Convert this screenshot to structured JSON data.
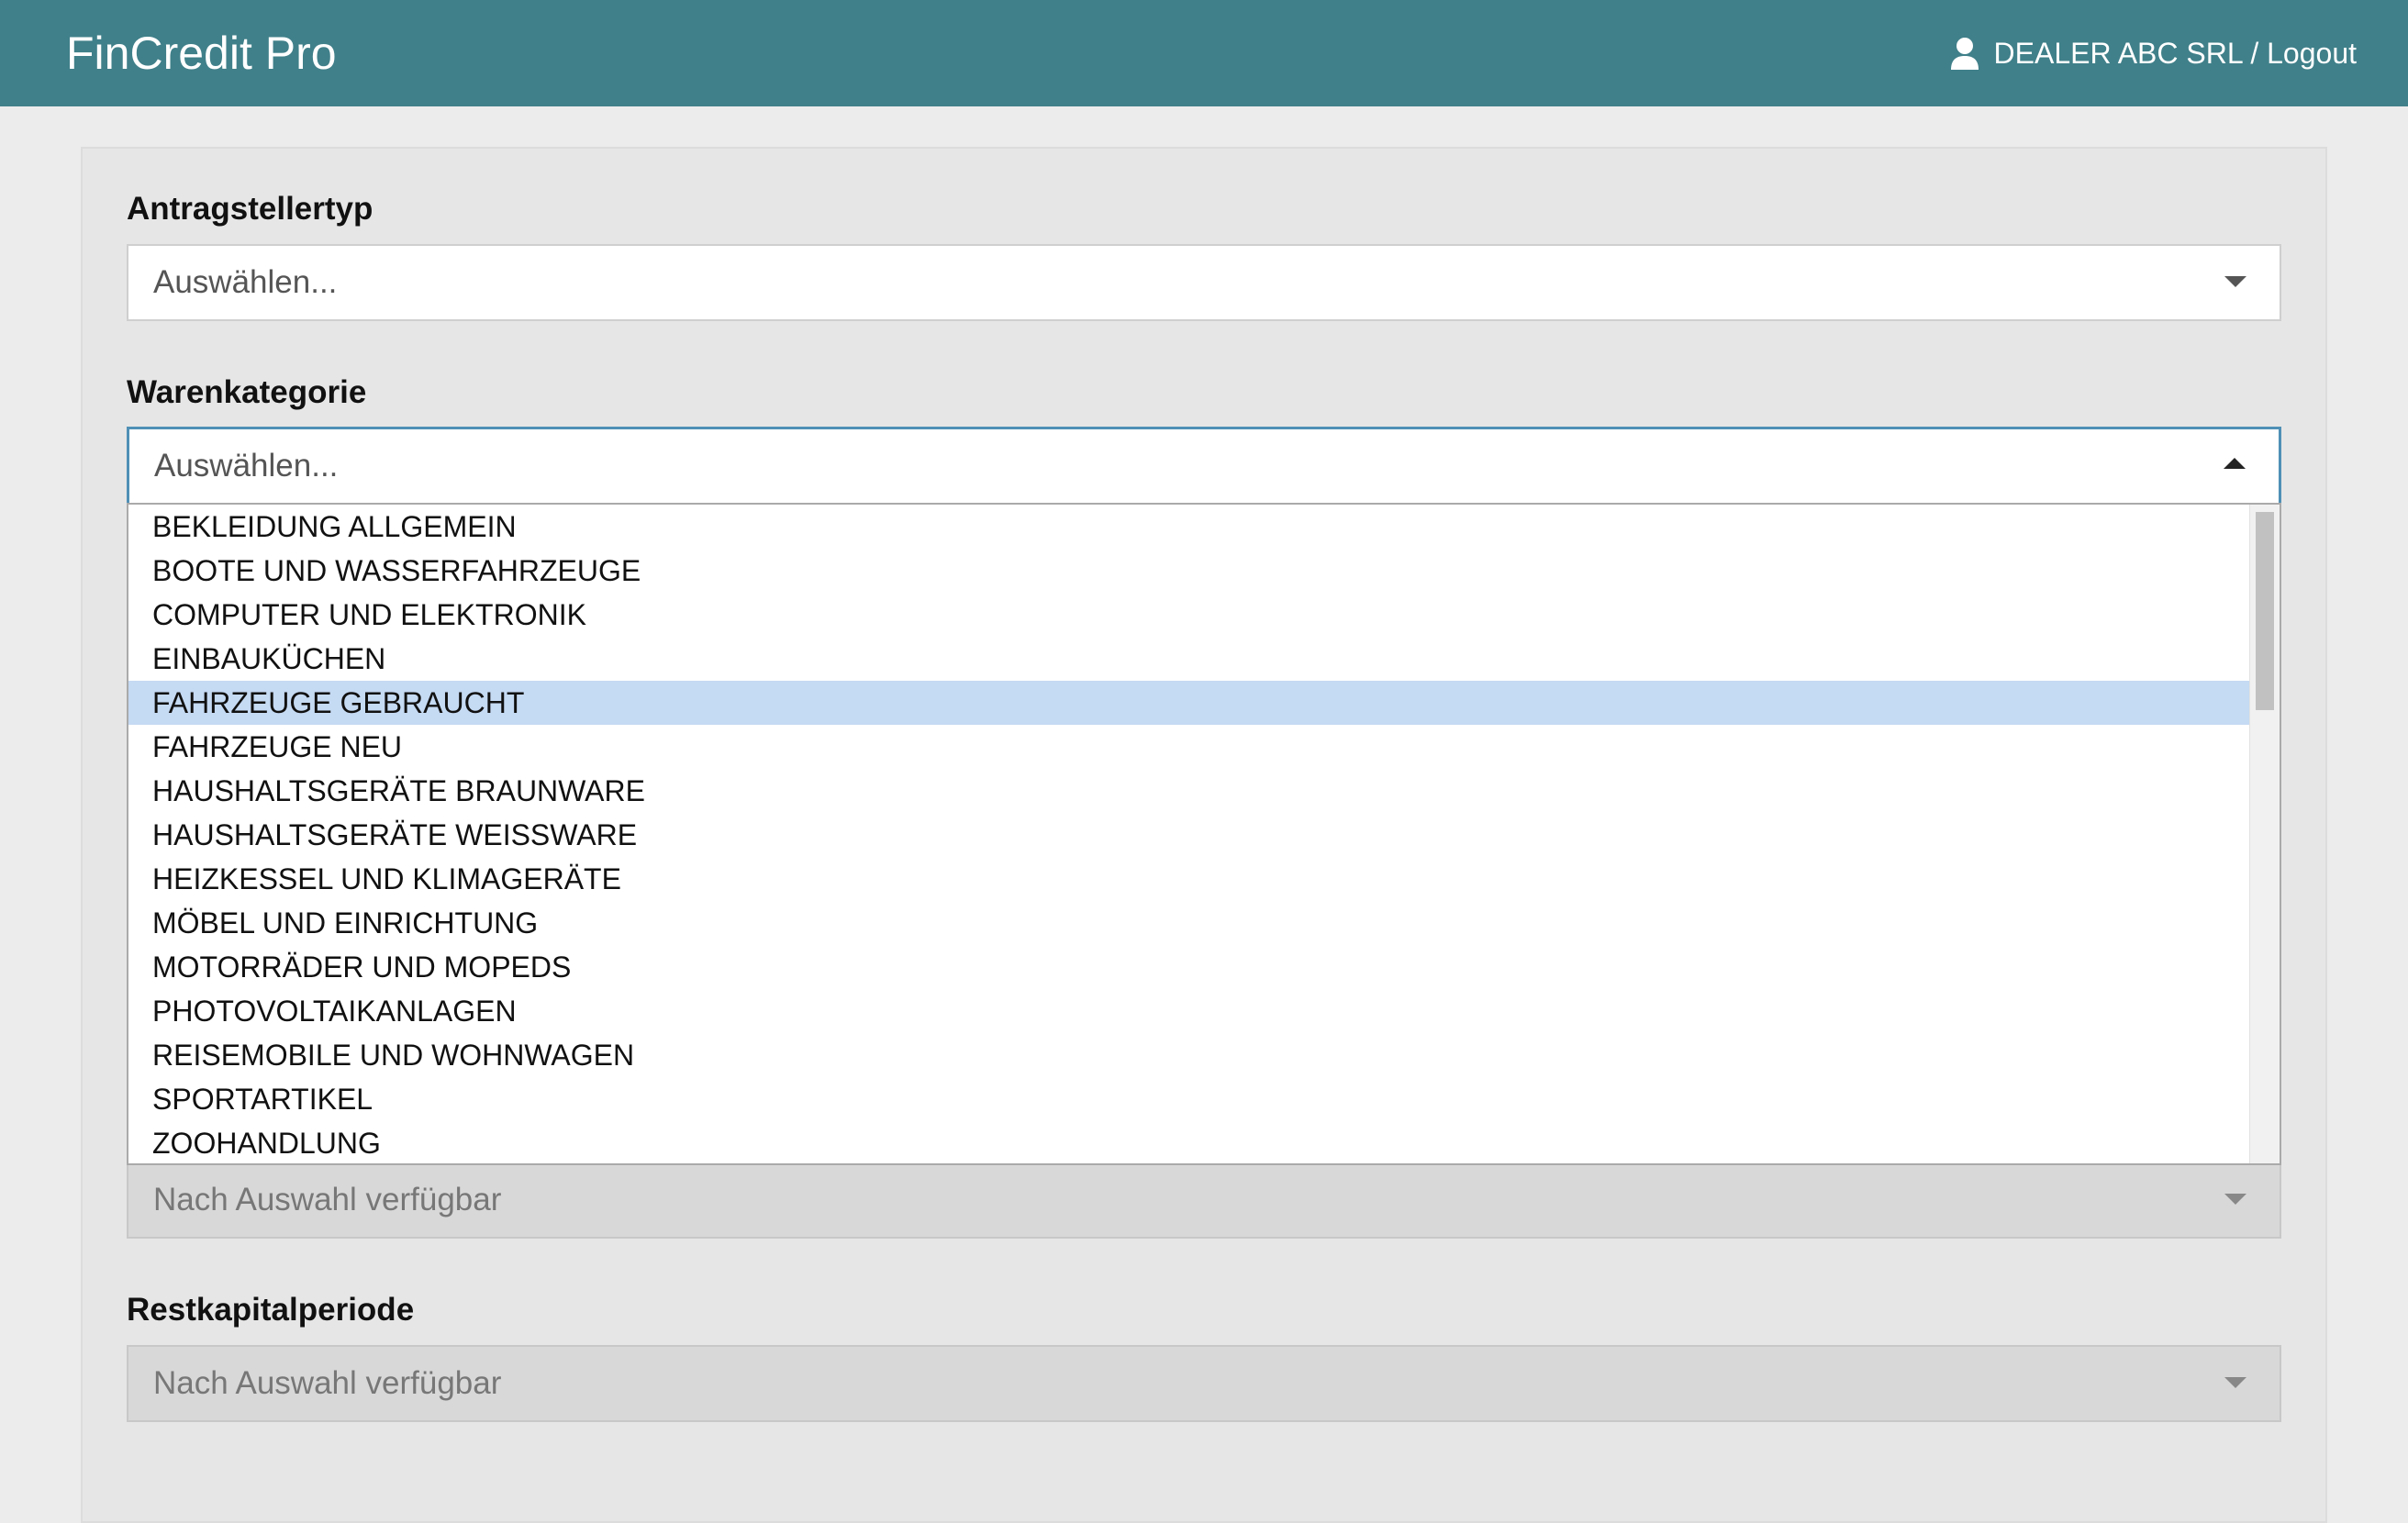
{
  "app": {
    "title": "FinCredit Pro",
    "user_label": "DEALER ABC SRL / Logout"
  },
  "colors": {
    "navbar": "#40808a",
    "highlight": "#c5daf3",
    "focus_border": "#4f90b5"
  },
  "form": {
    "applicant_type": {
      "label": "Antragstellertyp",
      "value": "Auswählen..."
    },
    "goods_category": {
      "label": "Warenkategorie",
      "value": "Auswählen...",
      "open": true,
      "highlighted": "FAHRZEUGE GEBRAUCHT",
      "options": [
        "BEKLEIDUNG ALLGEMEIN",
        "BOOTE UND WASSERFAHRZEUGE",
        "COMPUTER UND ELEKTRONIK",
        "EINBAUKÜCHEN",
        "FAHRZEUGE GEBRAUCHT",
        "FAHRZEUGE NEU",
        "HAUSHALTSGERÄTE BRAUNWARE",
        "HAUSHALTSGERÄTE WEISSWARE",
        "HEIZKESSEL UND KLIMAGERÄTE",
        "MÖBEL UND EINRICHTUNG",
        "MOTORRÄDER UND MOPEDS",
        "PHOTOVOLTAIKANLAGEN",
        "REISEMOBILE UND WOHNWAGEN",
        "SPORTARTIKEL",
        "ZOOHANDLUNG"
      ]
    },
    "hidden_field": {
      "value": "Nach Auswahl verfügbar"
    },
    "residual_period": {
      "label": "Restkapitalperiode",
      "value": "Nach Auswahl verfügbar"
    }
  }
}
